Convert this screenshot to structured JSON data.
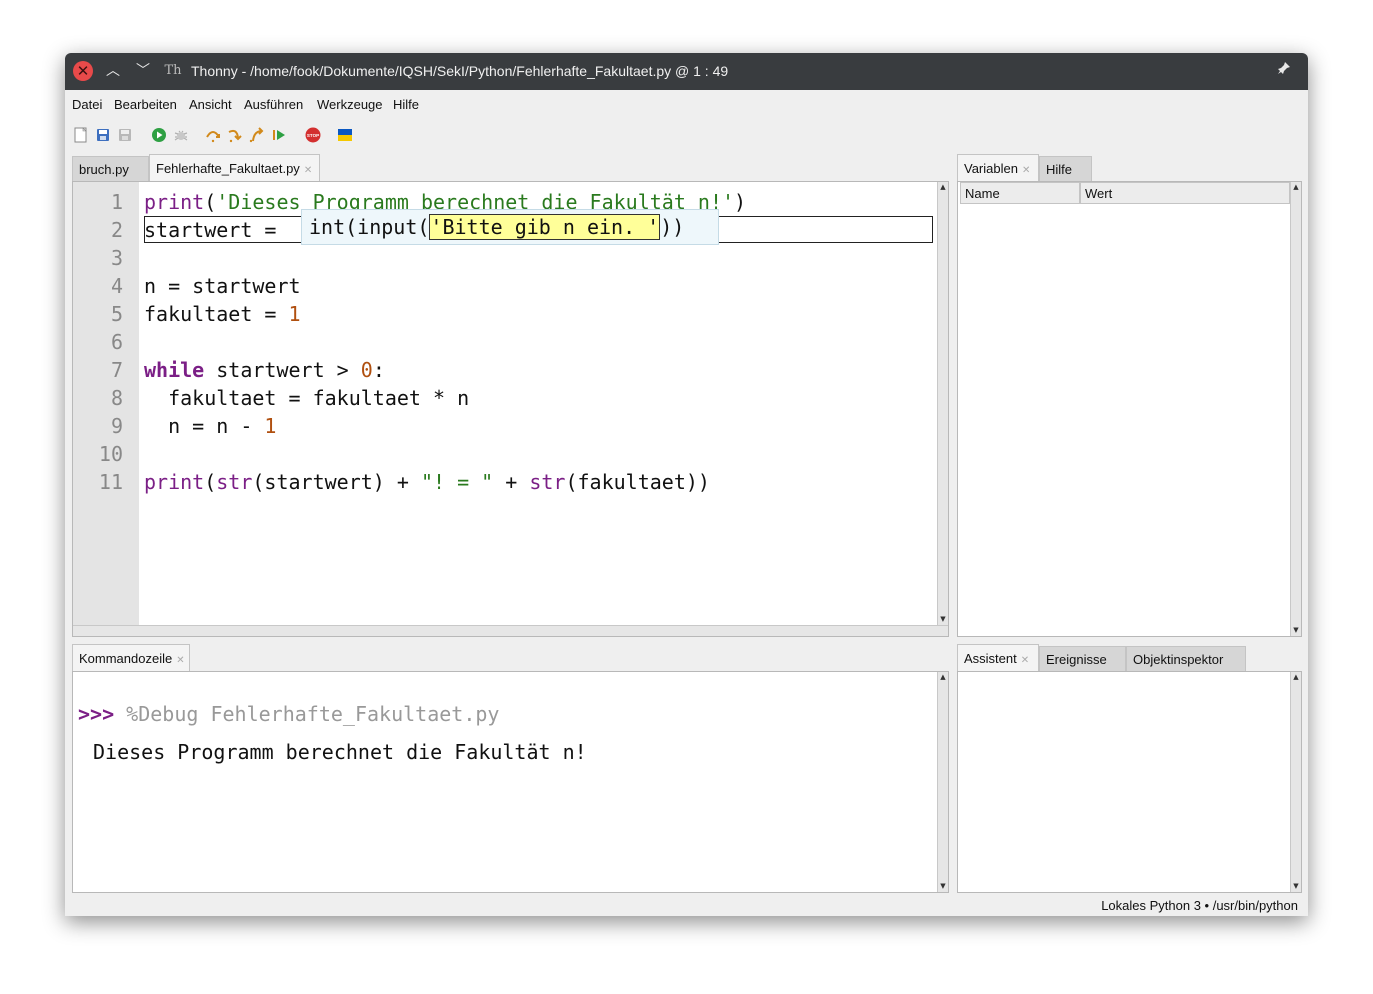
{
  "titlebar": {
    "title": "Thonny - /home/fook/Dokumente/IQSH/SekI/Python/Fehlerhafte_Fakultaet.py @ 1 : 49",
    "close_glyph": "✕",
    "up_glyph": "︿",
    "down_glyph": "﹀",
    "font_glyph": "Th",
    "pin_glyph": "📌"
  },
  "menu": [
    "Datei",
    "Bearbeiten",
    "Ansicht",
    "Ausführen",
    "Werkzeuge",
    "Hilfe"
  ],
  "editor": {
    "tabs": [
      {
        "label": "bruch.py",
        "active": false
      },
      {
        "label": "Fehlerhafte_Fakultaet.py",
        "active": true
      }
    ],
    "line_numbers": [
      "1",
      "2",
      "3",
      "4",
      "5",
      "6",
      "7",
      "8",
      "9",
      "10",
      "11"
    ],
    "calltip": {
      "prefix": "int(input(",
      "highlight": "'Bitte gib n ein. '",
      "suffix": "))"
    }
  },
  "variables_panel": {
    "tabs": [
      {
        "label": "Variablen",
        "active": true
      },
      {
        "label": "Hilfe",
        "active": false
      }
    ],
    "columns": [
      "Name",
      "Wert"
    ]
  },
  "shell_panel": {
    "tab": "Kommandozeile",
    "prompt": ">>>",
    "command": "%Debug Fehlerhafte_Fakultaet.py",
    "output": "Dieses Programm berechnet die Fakultät n!"
  },
  "assistant_panel": {
    "tabs": [
      {
        "label": "Assistent",
        "active": true
      },
      {
        "label": "Ereignisse",
        "active": false
      },
      {
        "label": "Objektinspektor",
        "active": false
      }
    ]
  },
  "status": "Lokales Python 3  •  /usr/bin/python",
  "colors": {
    "keyword": "#7b1f86",
    "string": "#2a7a1e",
    "number": "#b05010",
    "calltip_highlight": "#ffff99"
  }
}
